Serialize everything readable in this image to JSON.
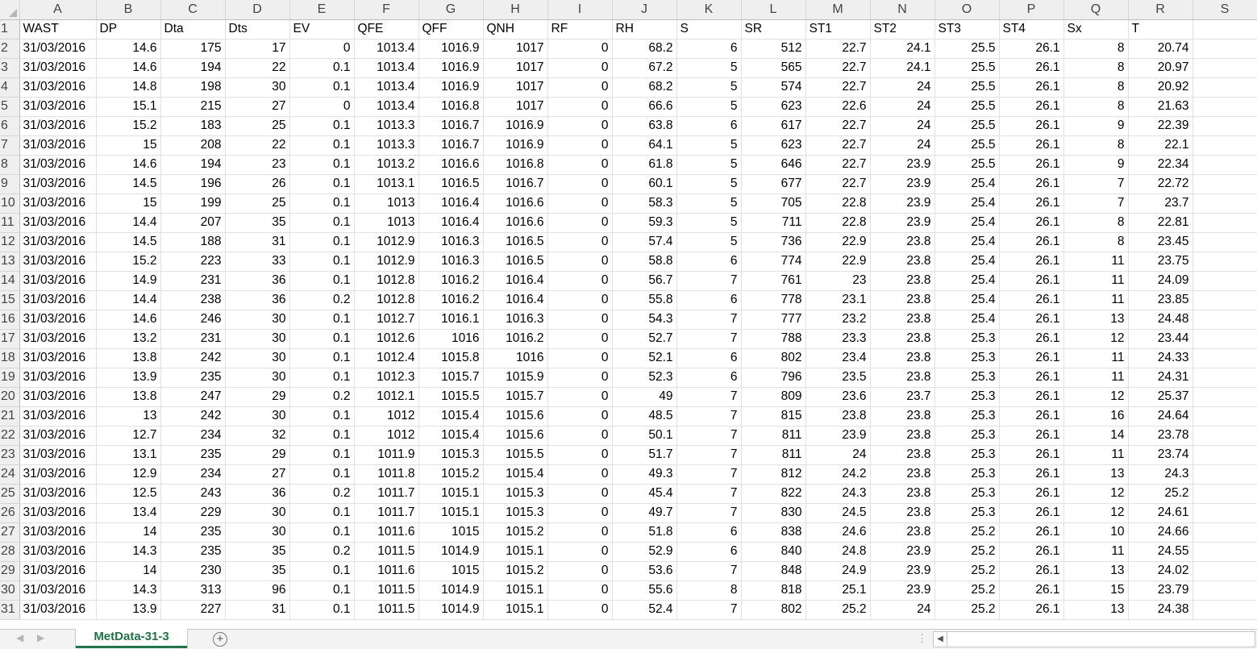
{
  "columns": [
    "A",
    "B",
    "C",
    "D",
    "E",
    "F",
    "G",
    "H",
    "I",
    "J",
    "K",
    "L",
    "M",
    "N",
    "O",
    "P",
    "Q",
    "R",
    "S"
  ],
  "headers": [
    "WAST",
    "DP",
    "Dta",
    "Dts",
    "EV",
    "QFE",
    "QFF",
    "QNH",
    "RF",
    "RH",
    "S",
    "SR",
    "ST1",
    "ST2",
    "ST3",
    "ST4",
    "Sx",
    "T",
    ""
  ],
  "rows": [
    [
      "31/03/2016",
      "14.6",
      "175",
      "17",
      "0",
      "1013.4",
      "1016.9",
      "1017",
      "0",
      "68.2",
      "6",
      "512",
      "22.7",
      "24.1",
      "25.5",
      "26.1",
      "8",
      "20.74"
    ],
    [
      "31/03/2016",
      "14.6",
      "194",
      "22",
      "0.1",
      "1013.4",
      "1016.9",
      "1017",
      "0",
      "67.2",
      "5",
      "565",
      "22.7",
      "24.1",
      "25.5",
      "26.1",
      "8",
      "20.97"
    ],
    [
      "31/03/2016",
      "14.8",
      "198",
      "30",
      "0.1",
      "1013.4",
      "1016.9",
      "1017",
      "0",
      "68.2",
      "5",
      "574",
      "22.7",
      "24",
      "25.5",
      "26.1",
      "8",
      "20.92"
    ],
    [
      "31/03/2016",
      "15.1",
      "215",
      "27",
      "0",
      "1013.4",
      "1016.8",
      "1017",
      "0",
      "66.6",
      "5",
      "623",
      "22.6",
      "24",
      "25.5",
      "26.1",
      "8",
      "21.63"
    ],
    [
      "31/03/2016",
      "15.2",
      "183",
      "25",
      "0.1",
      "1013.3",
      "1016.7",
      "1016.9",
      "0",
      "63.8",
      "6",
      "617",
      "22.7",
      "24",
      "25.5",
      "26.1",
      "9",
      "22.39"
    ],
    [
      "31/03/2016",
      "15",
      "208",
      "22",
      "0.1",
      "1013.3",
      "1016.7",
      "1016.9",
      "0",
      "64.1",
      "5",
      "623",
      "22.7",
      "24",
      "25.5",
      "26.1",
      "8",
      "22.1"
    ],
    [
      "31/03/2016",
      "14.6",
      "194",
      "23",
      "0.1",
      "1013.2",
      "1016.6",
      "1016.8",
      "0",
      "61.8",
      "5",
      "646",
      "22.7",
      "23.9",
      "25.5",
      "26.1",
      "9",
      "22.34"
    ],
    [
      "31/03/2016",
      "14.5",
      "196",
      "26",
      "0.1",
      "1013.1",
      "1016.5",
      "1016.7",
      "0",
      "60.1",
      "5",
      "677",
      "22.7",
      "23.9",
      "25.4",
      "26.1",
      "7",
      "22.72"
    ],
    [
      "31/03/2016",
      "15",
      "199",
      "25",
      "0.1",
      "1013",
      "1016.4",
      "1016.6",
      "0",
      "58.3",
      "5",
      "705",
      "22.8",
      "23.9",
      "25.4",
      "26.1",
      "7",
      "23.7"
    ],
    [
      "31/03/2016",
      "14.4",
      "207",
      "35",
      "0.1",
      "1013",
      "1016.4",
      "1016.6",
      "0",
      "59.3",
      "5",
      "711",
      "22.8",
      "23.9",
      "25.4",
      "26.1",
      "8",
      "22.81"
    ],
    [
      "31/03/2016",
      "14.5",
      "188",
      "31",
      "0.1",
      "1012.9",
      "1016.3",
      "1016.5",
      "0",
      "57.4",
      "5",
      "736",
      "22.9",
      "23.8",
      "25.4",
      "26.1",
      "8",
      "23.45"
    ],
    [
      "31/03/2016",
      "15.2",
      "223",
      "33",
      "0.1",
      "1012.9",
      "1016.3",
      "1016.5",
      "0",
      "58.8",
      "6",
      "774",
      "22.9",
      "23.8",
      "25.4",
      "26.1",
      "11",
      "23.75"
    ],
    [
      "31/03/2016",
      "14.9",
      "231",
      "36",
      "0.1",
      "1012.8",
      "1016.2",
      "1016.4",
      "0",
      "56.7",
      "7",
      "761",
      "23",
      "23.8",
      "25.4",
      "26.1",
      "11",
      "24.09"
    ],
    [
      "31/03/2016",
      "14.4",
      "238",
      "36",
      "0.2",
      "1012.8",
      "1016.2",
      "1016.4",
      "0",
      "55.8",
      "6",
      "778",
      "23.1",
      "23.8",
      "25.4",
      "26.1",
      "11",
      "23.85"
    ],
    [
      "31/03/2016",
      "14.6",
      "246",
      "30",
      "0.1",
      "1012.7",
      "1016.1",
      "1016.3",
      "0",
      "54.3",
      "7",
      "777",
      "23.2",
      "23.8",
      "25.4",
      "26.1",
      "13",
      "24.48"
    ],
    [
      "31/03/2016",
      "13.2",
      "231",
      "30",
      "0.1",
      "1012.6",
      "1016",
      "1016.2",
      "0",
      "52.7",
      "7",
      "788",
      "23.3",
      "23.8",
      "25.3",
      "26.1",
      "12",
      "23.44"
    ],
    [
      "31/03/2016",
      "13.8",
      "242",
      "30",
      "0.1",
      "1012.4",
      "1015.8",
      "1016",
      "0",
      "52.1",
      "6",
      "802",
      "23.4",
      "23.8",
      "25.3",
      "26.1",
      "11",
      "24.33"
    ],
    [
      "31/03/2016",
      "13.9",
      "235",
      "30",
      "0.1",
      "1012.3",
      "1015.7",
      "1015.9",
      "0",
      "52.3",
      "6",
      "796",
      "23.5",
      "23.8",
      "25.3",
      "26.1",
      "11",
      "24.31"
    ],
    [
      "31/03/2016",
      "13.8",
      "247",
      "29",
      "0.2",
      "1012.1",
      "1015.5",
      "1015.7",
      "0",
      "49",
      "7",
      "809",
      "23.6",
      "23.7",
      "25.3",
      "26.1",
      "12",
      "25.37"
    ],
    [
      "31/03/2016",
      "13",
      "242",
      "30",
      "0.1",
      "1012",
      "1015.4",
      "1015.6",
      "0",
      "48.5",
      "7",
      "815",
      "23.8",
      "23.8",
      "25.3",
      "26.1",
      "16",
      "24.64"
    ],
    [
      "31/03/2016",
      "12.7",
      "234",
      "32",
      "0.1",
      "1012",
      "1015.4",
      "1015.6",
      "0",
      "50.1",
      "7",
      "811",
      "23.9",
      "23.8",
      "25.3",
      "26.1",
      "14",
      "23.78"
    ],
    [
      "31/03/2016",
      "13.1",
      "235",
      "29",
      "0.1",
      "1011.9",
      "1015.3",
      "1015.5",
      "0",
      "51.7",
      "7",
      "811",
      "24",
      "23.8",
      "25.3",
      "26.1",
      "11",
      "23.74"
    ],
    [
      "31/03/2016",
      "12.9",
      "234",
      "27",
      "0.1",
      "1011.8",
      "1015.2",
      "1015.4",
      "0",
      "49.3",
      "7",
      "812",
      "24.2",
      "23.8",
      "25.3",
      "26.1",
      "13",
      "24.3"
    ],
    [
      "31/03/2016",
      "12.5",
      "243",
      "36",
      "0.2",
      "1011.7",
      "1015.1",
      "1015.3",
      "0",
      "45.4",
      "7",
      "822",
      "24.3",
      "23.8",
      "25.3",
      "26.1",
      "12",
      "25.2"
    ],
    [
      "31/03/2016",
      "13.4",
      "229",
      "30",
      "0.1",
      "1011.7",
      "1015.1",
      "1015.3",
      "0",
      "49.7",
      "7",
      "830",
      "24.5",
      "23.8",
      "25.3",
      "26.1",
      "12",
      "24.61"
    ],
    [
      "31/03/2016",
      "14",
      "235",
      "30",
      "0.1",
      "1011.6",
      "1015",
      "1015.2",
      "0",
      "51.8",
      "6",
      "838",
      "24.6",
      "23.8",
      "25.2",
      "26.1",
      "10",
      "24.66"
    ],
    [
      "31/03/2016",
      "14.3",
      "235",
      "35",
      "0.2",
      "1011.5",
      "1014.9",
      "1015.1",
      "0",
      "52.9",
      "6",
      "840",
      "24.8",
      "23.9",
      "25.2",
      "26.1",
      "11",
      "24.55"
    ],
    [
      "31/03/2016",
      "14",
      "230",
      "35",
      "0.1",
      "1011.6",
      "1015",
      "1015.2",
      "0",
      "53.6",
      "7",
      "848",
      "24.9",
      "23.9",
      "25.2",
      "26.1",
      "13",
      "24.02"
    ],
    [
      "31/03/2016",
      "14.3",
      "313",
      "96",
      "0.1",
      "1011.5",
      "1014.9",
      "1015.1",
      "0",
      "55.6",
      "8",
      "818",
      "25.1",
      "23.9",
      "25.2",
      "26.1",
      "15",
      "23.79"
    ],
    [
      "31/03/2016",
      "13.9",
      "227",
      "31",
      "0.1",
      "1011.5",
      "1014.9",
      "1015.1",
      "0",
      "52.4",
      "7",
      "802",
      "25.2",
      "24",
      "25.2",
      "26.1",
      "13",
      "24.38"
    ]
  ],
  "tabs": {
    "active": "MetData-31-3"
  },
  "icons": {
    "nav_left": "chevron-left-icon",
    "nav_right": "chevron-right-icon",
    "add_sheet": "plus-circle-icon",
    "scroll_left": "scroll-left-arrow-icon"
  },
  "colors": {
    "tab_accent": "#217346",
    "header_bg": "#efefef",
    "grid": "#e1e1e1"
  }
}
